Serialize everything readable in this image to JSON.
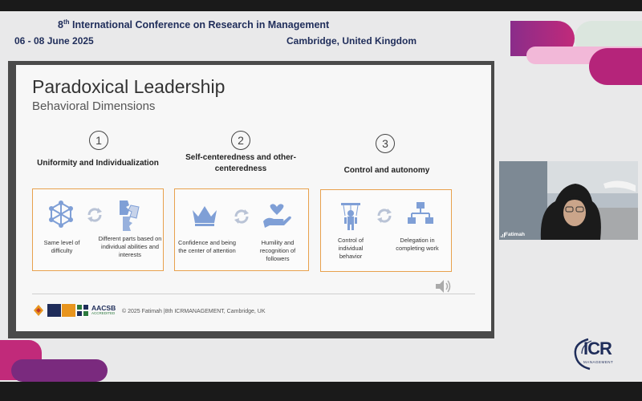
{
  "header": {
    "conference_ordinal": "8",
    "conference_ordinal_suffix": "th",
    "conference_name": "International Conference on Research in Management",
    "dates": "06 - 08 June 2025",
    "location": "Cambridge, United Kingdom"
  },
  "slide": {
    "title": "Paradoxical Leadership",
    "subtitle": "Behavioral Dimensions",
    "dimensions": [
      {
        "number": "1",
        "title": "Uniformity and Individualization",
        "left_label": "Same level of difficulty",
        "left_icon": "network-icon",
        "right_label": "Different parts based on individual abilities and interests",
        "right_icon": "puzzle-pieces-icon"
      },
      {
        "number": "2",
        "title": "Self-centeredness and other-centeredness",
        "left_label": "Confidence and being the center of attention",
        "left_icon": "crown-icon",
        "right_label": "Humility and recognition of followers",
        "right_icon": "heart-hand-icon"
      },
      {
        "number": "3",
        "title": "Control and autonomy",
        "left_label": "Control of individual behavior",
        "left_icon": "puppet-icon",
        "right_label": "Delegation in completing work",
        "right_icon": "hierarchy-icon"
      }
    ],
    "footer_logos": {
      "aacsb": "AACSB",
      "aacsb_sub": "ACCREDITED"
    },
    "footer_text": "© 2025 Fatimah  |8th ICRMANAGEMENT, Cambridge, UK"
  },
  "video": {
    "participant_name": "Fatimah"
  },
  "logo": {
    "text": "ICR",
    "sub": "MANAGEMENT"
  },
  "colors": {
    "accent_pink": "#b5247a",
    "accent_purple": "#7a2a7e",
    "box_border": "#e8a14d",
    "icon_blue": "#7f9fd6",
    "navy": "#1f2d5a"
  }
}
